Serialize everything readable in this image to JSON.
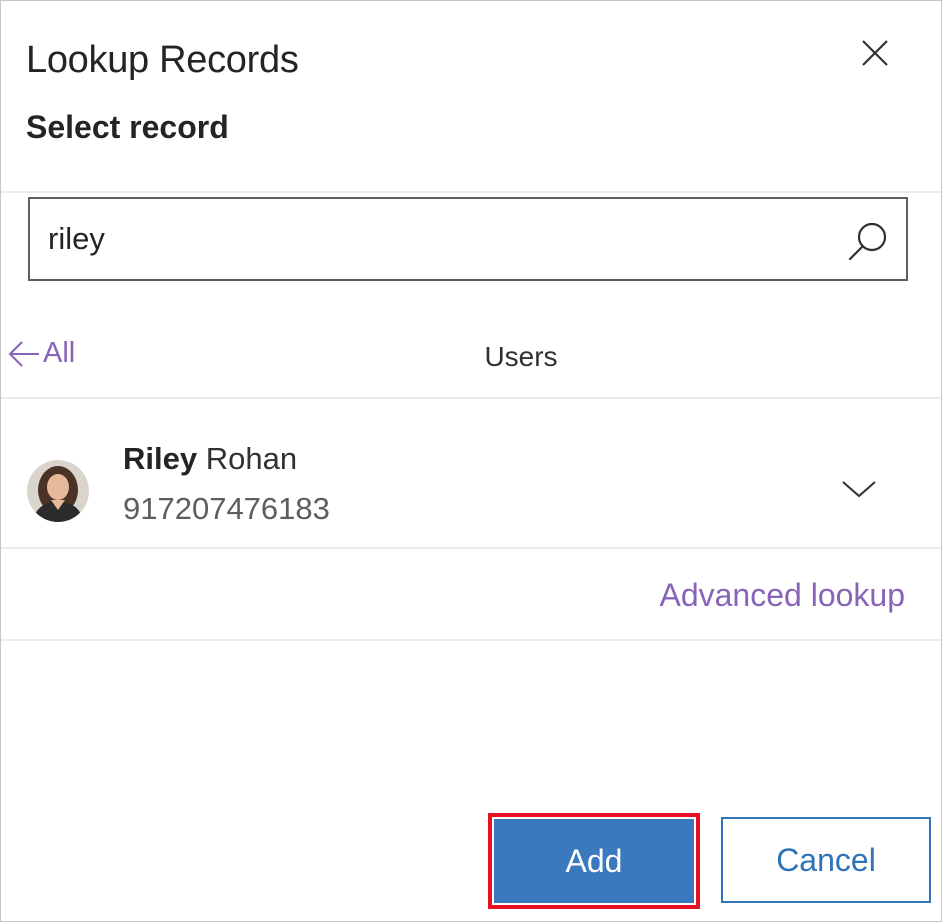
{
  "dialog": {
    "title": "Lookup Records",
    "subtitle": "Select record",
    "close_icon": "close-icon"
  },
  "search": {
    "value": "riley",
    "icon": "search-icon"
  },
  "results": {
    "back_label": "All",
    "back_icon": "arrow-left-icon",
    "section_title": "Users",
    "records": [
      {
        "name_match": "Riley",
        "name_rest": "Rohan",
        "secondary": "917207476183",
        "avatar_icon": "user-photo",
        "expand_icon": "chevron-down-icon"
      }
    ],
    "advanced_lookup": "Advanced lookup"
  },
  "footer": {
    "add_label": "Add",
    "cancel_label": "Cancel"
  },
  "colors": {
    "accent": "#8764b8",
    "primary_button": "#3b79bf",
    "highlight_outline": "#e81123",
    "border": "#605e5c"
  }
}
